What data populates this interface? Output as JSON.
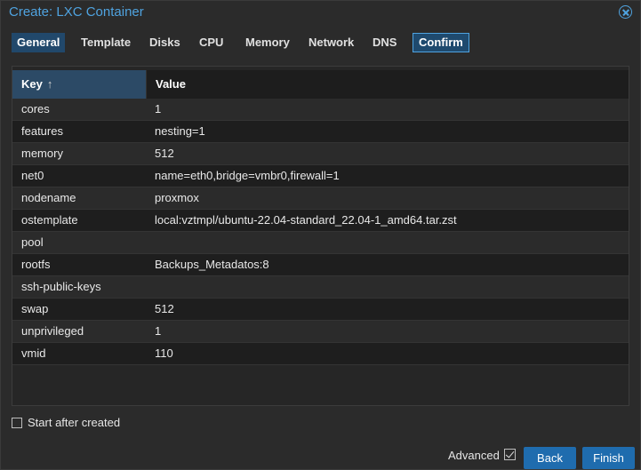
{
  "window": {
    "title": "Create: LXC Container"
  },
  "tabs": [
    {
      "label": "General"
    },
    {
      "label": "Template"
    },
    {
      "label": "Disks"
    },
    {
      "label": "CPU"
    },
    {
      "label": "Memory"
    },
    {
      "label": "Network"
    },
    {
      "label": "DNS"
    },
    {
      "label": "Confirm"
    }
  ],
  "grid": {
    "columns": {
      "key": "Key",
      "value": "Value"
    },
    "sort_indicator": "↑",
    "rows": [
      {
        "key": "cores",
        "value": "1"
      },
      {
        "key": "features",
        "value": "nesting=1"
      },
      {
        "key": "memory",
        "value": "512"
      },
      {
        "key": "net0",
        "value": "name=eth0,bridge=vmbr0,firewall=1"
      },
      {
        "key": "nodename",
        "value": "proxmox"
      },
      {
        "key": "ostemplate",
        "value": "local:vztmpl/ubuntu-22.04-standard_22.04-1_amd64.tar.zst"
      },
      {
        "key": "pool",
        "value": ""
      },
      {
        "key": "rootfs",
        "value": "Backups_Metadatos:8"
      },
      {
        "key": "ssh-public-keys",
        "value": ""
      },
      {
        "key": "swap",
        "value": "512"
      },
      {
        "key": "unprivileged",
        "value": "1"
      },
      {
        "key": "vmid",
        "value": "110"
      }
    ]
  },
  "start_after_created": {
    "label": "Start after created",
    "checked": false
  },
  "footer": {
    "advanced_label": "Advanced",
    "advanced_checked": true,
    "back_label": "Back",
    "finish_label": "Finish"
  },
  "colors": {
    "accent": "#4fa3e0",
    "button": "#1f6cae",
    "active_tab": "#21486b",
    "background": "#2b2b2b"
  }
}
